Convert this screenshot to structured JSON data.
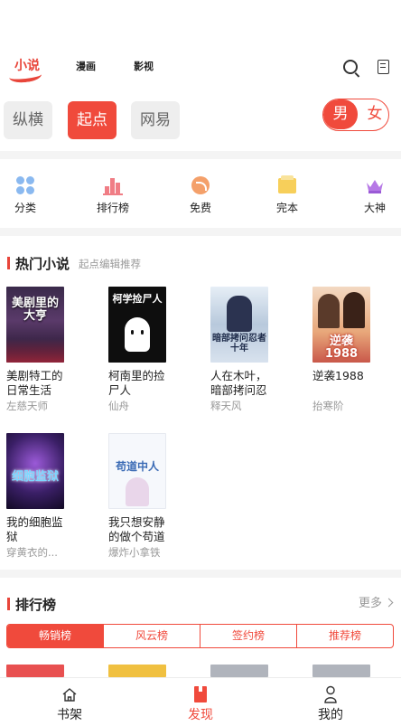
{
  "header": {
    "logo_text": "小说",
    "tabs": [
      "漫画",
      "影视"
    ]
  },
  "sources": [
    "纵横",
    "起点",
    "网易"
  ],
  "gender": {
    "male": "男",
    "female": "女",
    "selected": "男"
  },
  "categories": [
    {
      "label": "分类",
      "icon": "grid-dots-icon"
    },
    {
      "label": "排行榜",
      "icon": "bar-chart-icon"
    },
    {
      "label": "免费",
      "icon": "coin-icon"
    },
    {
      "label": "完本",
      "icon": "folder-icon"
    },
    {
      "label": "大神",
      "icon": "crown-icon"
    }
  ],
  "hot": {
    "title": "热门小说",
    "subtitle": "起点编辑推荐",
    "books": [
      {
        "title": "美剧特工的日常生活",
        "author": "左慈天师",
        "cover_text": "美剧里的大亨",
        "cover_color": "#2a1a3a"
      },
      {
        "title": "柯南里的捡尸人",
        "author": "仙舟",
        "cover_text": "柯学捡尸人",
        "cover_color": "#111111"
      },
      {
        "title": "人在木叶，暗部拷问忍",
        "author": "释天风",
        "cover_text": "暗部拷问忍者十年",
        "cover_color": "#c9d7e6"
      },
      {
        "title": "逆袭1988",
        "author": "抬寒阶",
        "cover_text": "逆袭1988",
        "cover_color": "#e9b78a"
      },
      {
        "title": "我的细胞监狱",
        "author": "穿黄衣的...",
        "cover_text": "细胞监狱",
        "cover_color": "#2b1b4a"
      },
      {
        "title": "我只想安静的做个苟道",
        "author": "爆炸小拿铁",
        "cover_text": "苟道中人",
        "cover_color": "#f5f7fb"
      }
    ]
  },
  "ranking": {
    "title": "排行榜",
    "more": "更多",
    "tabs": [
      "畅销榜",
      "风云榜",
      "签约榜",
      "推荐榜"
    ]
  },
  "nav": [
    {
      "label": "书架",
      "icon": "home-icon"
    },
    {
      "label": "发现",
      "icon": "bookmark-icon",
      "active": true
    },
    {
      "label": "我的",
      "icon": "person-icon"
    }
  ]
}
